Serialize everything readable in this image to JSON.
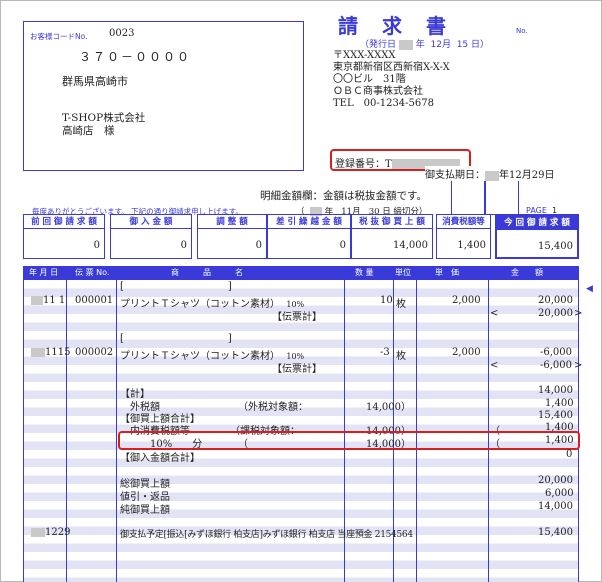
{
  "title": "請　求　書",
  "doc_no_label": "No.",
  "issue": {
    "prefix": "（発行日",
    "nen": "年",
    "month": "12月",
    "day": "15 日）"
  },
  "customer": {
    "code_label": "お客様コードNo.",
    "code": "0023",
    "postal": "３７０－００００",
    "address": "群馬県高崎市",
    "company": "T-SHOP株式会社",
    "branch": "高崎店　様"
  },
  "issuer": {
    "postal": "〒XXX-XXXX",
    "address": "東京都新宿区西新宿X-X-X",
    "building": "〇〇ビル　31階",
    "company": "ＯＢＣ商事株式会社",
    "tel": "TEL　00-1234-5678"
  },
  "registration_label": "登録番号：T",
  "payment_due_label": "御支払期日：",
  "payment_due_date": "年12月29日",
  "tax_note": "明細金額欄：金額は税抜金額です。",
  "thanks": "毎度ありがとうございます。 下記の通り御請求申し上げます。",
  "closing": {
    "open": "（",
    "nen": "年",
    "month": "11月",
    "day": "30 日 締切分）"
  },
  "page_label": "PAGE",
  "page_no": "1",
  "summary": [
    {
      "label": "前 回 御 請 求 額",
      "value": "0"
    },
    {
      "label": "御 入 金 額",
      "value": "0"
    },
    {
      "label": "調 整 額",
      "value": "0"
    },
    {
      "label": "差 引 繰 越 金 額",
      "value": "0"
    },
    {
      "label": "税 抜 御 買 上 額",
      "value": "14,000"
    },
    {
      "label": "消費税額等",
      "value": "1,400"
    },
    {
      "label": "今 回 御 請 求 額",
      "value": "15,400"
    }
  ],
  "columns": {
    "date": "年 月 日",
    "slip": "伝 票 No.",
    "item": "商　　　品　　　名",
    "qty": "数 量",
    "unit": "単位",
    "price": "単　価",
    "amount": "金　　額"
  },
  "rows": {
    "r1_date": "11 1",
    "r1_slip": "000001",
    "bracket_open": "[",
    "bracket_close": "]",
    "item_name": "プリントＴシャツ（コットン素材）",
    "tax_rate": "10%",
    "r1_qty": "10",
    "unit": "枚",
    "price": "2,000",
    "r1_amount": "20,000",
    "slip_total_label": "【伝票計】",
    "lt": "<",
    "gt": ">",
    "r1_slip_total": "20,000",
    "r2_date": "1115",
    "r2_slip": "000002",
    "r2_qty": "-3",
    "r2_amount": "-6,000",
    "r2_slip_total": "-6,000",
    "total_label": "【計】",
    "total": "14,000",
    "ext_tax_label": "外税額",
    "ext_tax_basis": "（外税対象額：",
    "ext_tax_base": "14,000",
    "close_paren": "）",
    "ext_tax": "1,400",
    "purchase_total_label": "【御買上額合計】",
    "purchase_total": "15,400",
    "int_tax_label": "内消費税額等",
    "int_tax_basis": "（課税対象額：",
    "int_tax_base": "14,000",
    "int_tax_open": "（",
    "int_tax": "1,400",
    "rate_label": "10%　　分",
    "rate_open": "（",
    "rate_base": "14,000",
    "rate_tax_open": "（",
    "rate_tax": "1,400",
    "payment_total_label": "【御入金額合計】",
    "payment_total": "0",
    "gross_label": "総御買上額",
    "gross": "20,000",
    "returns_label": "値引・返品",
    "returns": "6,000",
    "net_label": "純御買上額",
    "net": "14,000",
    "last_date": "1229",
    "bank_text": "御支払予定[振込[みずほ銀行 柏支店]みずほ銀行 柏支店 当座預金 2154564",
    "last_amount": "15,400"
  }
}
